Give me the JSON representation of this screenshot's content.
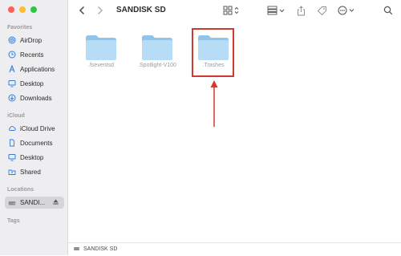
{
  "window": {
    "title": "SANDISK SD",
    "traffic_colors": [
      "#ff5f57",
      "#febc2e",
      "#28c840"
    ]
  },
  "toolbar": {
    "back_icon": "chevron-left-icon",
    "forward_icon": "chevron-right-icon",
    "view_icon": "grid-view-icon",
    "group_icon": "group-icon",
    "share_icon": "share-icon",
    "tag_icon": "tag-icon",
    "more_icon": "ellipsis-circle-icon",
    "search_icon": "search-icon"
  },
  "sidebar": {
    "favorites_label": "Favorites",
    "favorites": [
      {
        "label": "AirDrop",
        "icon": "airdrop-icon"
      },
      {
        "label": "Recents",
        "icon": "clock-icon"
      },
      {
        "label": "Applications",
        "icon": "applications-icon"
      },
      {
        "label": "Desktop",
        "icon": "desktop-icon"
      },
      {
        "label": "Downloads",
        "icon": "downloads-icon"
      }
    ],
    "icloud_label": "iCloud",
    "icloud": [
      {
        "label": "iCloud Drive",
        "icon": "cloud-icon"
      },
      {
        "label": "Documents",
        "icon": "document-icon"
      },
      {
        "label": "Desktop",
        "icon": "desktop-icon"
      },
      {
        "label": "Shared",
        "icon": "shared-folder-icon"
      }
    ],
    "locations_label": "Locations",
    "locations": [
      {
        "label": "SANDI...",
        "icon": "drive-icon",
        "eject_icon": "eject-icon"
      }
    ],
    "tags_label": "Tags"
  },
  "content": {
    "folders": [
      {
        "name": ".fseventsd"
      },
      {
        "name": ".Spotlight-V100"
      },
      {
        "name": ".Trashes"
      }
    ],
    "accent_color": "#cf3a30",
    "folder_color": "#a9d4f2"
  },
  "pathbar": {
    "label": "SANDISK SD",
    "icon": "drive-icon"
  }
}
